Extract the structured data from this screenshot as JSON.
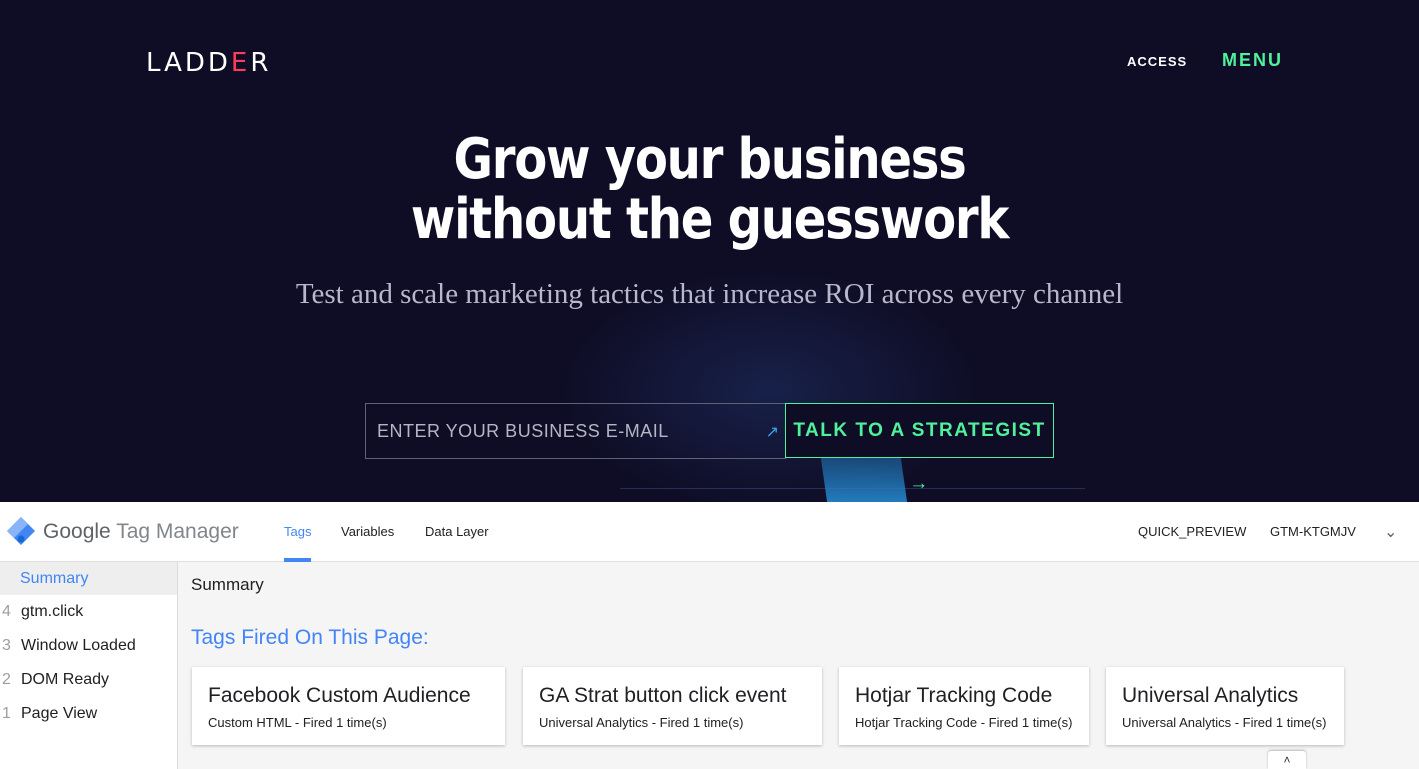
{
  "hero": {
    "logo_prefix": "LADD",
    "logo_mark": "E",
    "logo_suffix": "R",
    "nav": {
      "access": "ACCESS",
      "menu": "MENU"
    },
    "headline_line1": "Grow your business",
    "headline_line2": "without the guesswork",
    "subhead": "Test and scale marketing tactics that increase ROI across every channel",
    "email_placeholder": "ENTER YOUR BUSINESS E-MAIL",
    "cta_label": "TALK TO A STRATEGIST →",
    "colors": {
      "background": "#0f0d26",
      "accent": "#4ff29a",
      "logo_mark": "#ff3b5c"
    }
  },
  "gtm": {
    "brand_google": "Google",
    "brand_product": "Tag Manager",
    "tabs": [
      {
        "label": "Tags",
        "active": true
      },
      {
        "label": "Variables",
        "active": false
      },
      {
        "label": "Data Layer",
        "active": false
      }
    ],
    "preview_name": "QUICK_PREVIEW",
    "container_id": "GTM-KTGMJV",
    "icons": {
      "logo": "gtm-diamond-icon",
      "dropdown": "chevron-down-icon"
    },
    "colors": {
      "accent": "#4285f4"
    }
  },
  "sidebar": {
    "summary_label": "Summary",
    "events": [
      {
        "num": "4",
        "label": "gtm.click"
      },
      {
        "num": "3",
        "label": "Window Loaded"
      },
      {
        "num": "2",
        "label": "DOM Ready"
      },
      {
        "num": "1",
        "label": "Page View"
      }
    ]
  },
  "main": {
    "title": "Summary",
    "tags_heading": "Tags Fired On This Page:",
    "cards": [
      {
        "title": "Facebook Custom Audience",
        "subtitle": "Custom HTML - Fired 1 time(s)"
      },
      {
        "title": "GA Strat button click event",
        "subtitle": "Universal Analytics - Fired 1 time(s)"
      },
      {
        "title": "Hotjar Tracking Code",
        "subtitle": "Hotjar Tracking Code - Fired 1 time(s)"
      },
      {
        "title": "Universal Analytics",
        "subtitle": "Universal Analytics - Fired 1 time(s)"
      }
    ],
    "scroll_up": "˄"
  }
}
